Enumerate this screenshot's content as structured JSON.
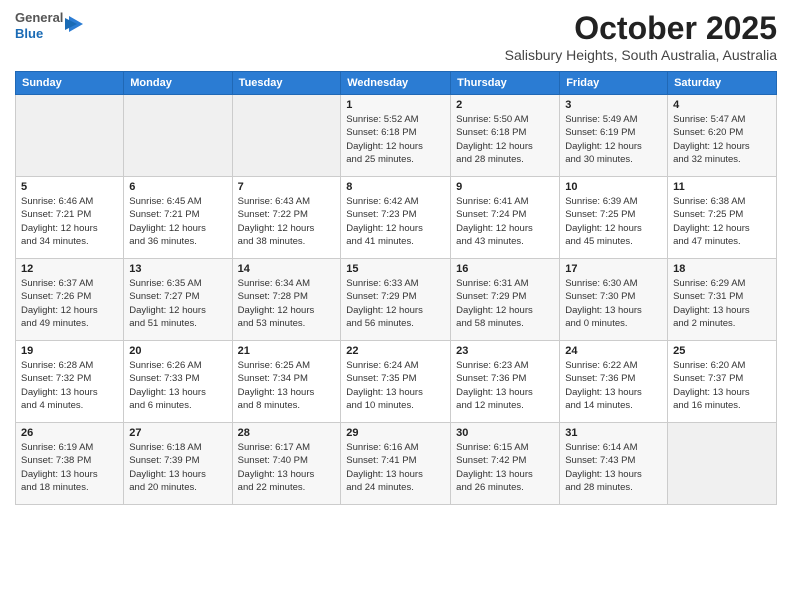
{
  "logo": {
    "general": "General",
    "blue": "Blue"
  },
  "header": {
    "month": "October 2025",
    "location": "Salisbury Heights, South Australia, Australia"
  },
  "weekdays": [
    "Sunday",
    "Monday",
    "Tuesday",
    "Wednesday",
    "Thursday",
    "Friday",
    "Saturday"
  ],
  "weeks": [
    [
      {
        "day": "",
        "info": ""
      },
      {
        "day": "",
        "info": ""
      },
      {
        "day": "",
        "info": ""
      },
      {
        "day": "1",
        "info": "Sunrise: 5:52 AM\nSunset: 6:18 PM\nDaylight: 12 hours\nand 25 minutes."
      },
      {
        "day": "2",
        "info": "Sunrise: 5:50 AM\nSunset: 6:18 PM\nDaylight: 12 hours\nand 28 minutes."
      },
      {
        "day": "3",
        "info": "Sunrise: 5:49 AM\nSunset: 6:19 PM\nDaylight: 12 hours\nand 30 minutes."
      },
      {
        "day": "4",
        "info": "Sunrise: 5:47 AM\nSunset: 6:20 PM\nDaylight: 12 hours\nand 32 minutes."
      }
    ],
    [
      {
        "day": "5",
        "info": "Sunrise: 6:46 AM\nSunset: 7:21 PM\nDaylight: 12 hours\nand 34 minutes."
      },
      {
        "day": "6",
        "info": "Sunrise: 6:45 AM\nSunset: 7:21 PM\nDaylight: 12 hours\nand 36 minutes."
      },
      {
        "day": "7",
        "info": "Sunrise: 6:43 AM\nSunset: 7:22 PM\nDaylight: 12 hours\nand 38 minutes."
      },
      {
        "day": "8",
        "info": "Sunrise: 6:42 AM\nSunset: 7:23 PM\nDaylight: 12 hours\nand 41 minutes."
      },
      {
        "day": "9",
        "info": "Sunrise: 6:41 AM\nSunset: 7:24 PM\nDaylight: 12 hours\nand 43 minutes."
      },
      {
        "day": "10",
        "info": "Sunrise: 6:39 AM\nSunset: 7:25 PM\nDaylight: 12 hours\nand 45 minutes."
      },
      {
        "day": "11",
        "info": "Sunrise: 6:38 AM\nSunset: 7:25 PM\nDaylight: 12 hours\nand 47 minutes."
      }
    ],
    [
      {
        "day": "12",
        "info": "Sunrise: 6:37 AM\nSunset: 7:26 PM\nDaylight: 12 hours\nand 49 minutes."
      },
      {
        "day": "13",
        "info": "Sunrise: 6:35 AM\nSunset: 7:27 PM\nDaylight: 12 hours\nand 51 minutes."
      },
      {
        "day": "14",
        "info": "Sunrise: 6:34 AM\nSunset: 7:28 PM\nDaylight: 12 hours\nand 53 minutes."
      },
      {
        "day": "15",
        "info": "Sunrise: 6:33 AM\nSunset: 7:29 PM\nDaylight: 12 hours\nand 56 minutes."
      },
      {
        "day": "16",
        "info": "Sunrise: 6:31 AM\nSunset: 7:29 PM\nDaylight: 12 hours\nand 58 minutes."
      },
      {
        "day": "17",
        "info": "Sunrise: 6:30 AM\nSunset: 7:30 PM\nDaylight: 13 hours\nand 0 minutes."
      },
      {
        "day": "18",
        "info": "Sunrise: 6:29 AM\nSunset: 7:31 PM\nDaylight: 13 hours\nand 2 minutes."
      }
    ],
    [
      {
        "day": "19",
        "info": "Sunrise: 6:28 AM\nSunset: 7:32 PM\nDaylight: 13 hours\nand 4 minutes."
      },
      {
        "day": "20",
        "info": "Sunrise: 6:26 AM\nSunset: 7:33 PM\nDaylight: 13 hours\nand 6 minutes."
      },
      {
        "day": "21",
        "info": "Sunrise: 6:25 AM\nSunset: 7:34 PM\nDaylight: 13 hours\nand 8 minutes."
      },
      {
        "day": "22",
        "info": "Sunrise: 6:24 AM\nSunset: 7:35 PM\nDaylight: 13 hours\nand 10 minutes."
      },
      {
        "day": "23",
        "info": "Sunrise: 6:23 AM\nSunset: 7:36 PM\nDaylight: 13 hours\nand 12 minutes."
      },
      {
        "day": "24",
        "info": "Sunrise: 6:22 AM\nSunset: 7:36 PM\nDaylight: 13 hours\nand 14 minutes."
      },
      {
        "day": "25",
        "info": "Sunrise: 6:20 AM\nSunset: 7:37 PM\nDaylight: 13 hours\nand 16 minutes."
      }
    ],
    [
      {
        "day": "26",
        "info": "Sunrise: 6:19 AM\nSunset: 7:38 PM\nDaylight: 13 hours\nand 18 minutes."
      },
      {
        "day": "27",
        "info": "Sunrise: 6:18 AM\nSunset: 7:39 PM\nDaylight: 13 hours\nand 20 minutes."
      },
      {
        "day": "28",
        "info": "Sunrise: 6:17 AM\nSunset: 7:40 PM\nDaylight: 13 hours\nand 22 minutes."
      },
      {
        "day": "29",
        "info": "Sunrise: 6:16 AM\nSunset: 7:41 PM\nDaylight: 13 hours\nand 24 minutes."
      },
      {
        "day": "30",
        "info": "Sunrise: 6:15 AM\nSunset: 7:42 PM\nDaylight: 13 hours\nand 26 minutes."
      },
      {
        "day": "31",
        "info": "Sunrise: 6:14 AM\nSunset: 7:43 PM\nDaylight: 13 hours\nand 28 minutes."
      },
      {
        "day": "",
        "info": ""
      }
    ]
  ]
}
